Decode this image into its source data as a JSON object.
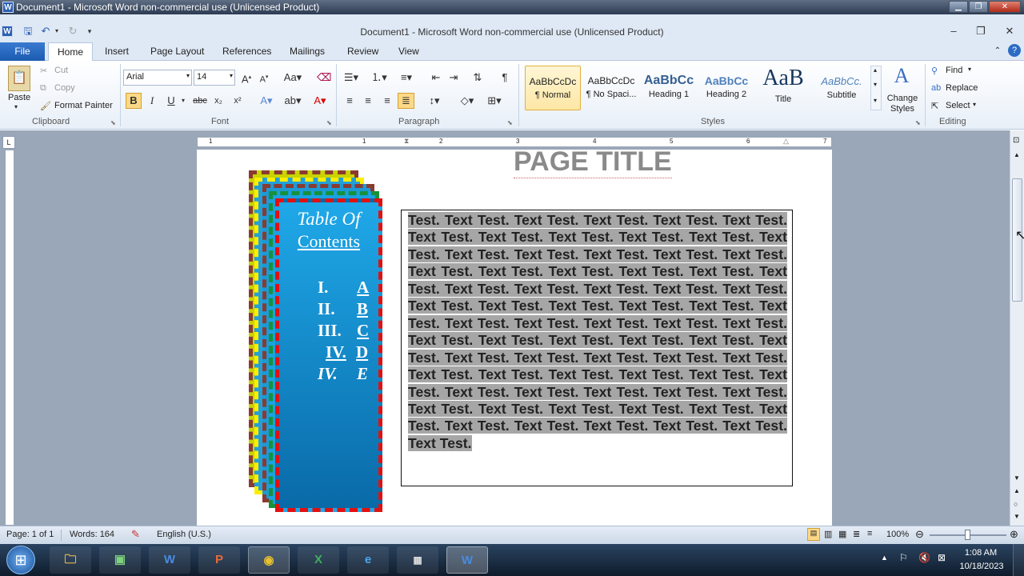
{
  "window": {
    "title": "Document1 - Microsoft Word non-commercial use (Unlicensed Product)",
    "doc_title": "Document1  -  Microsoft Word non-commercial use (Unlicensed Product)",
    "app_icon": "W"
  },
  "tabs": [
    "File",
    "Home",
    "Insert",
    "Page Layout",
    "References",
    "Mailings",
    "Review",
    "View"
  ],
  "ribbon": {
    "clipboard": {
      "paste": "Paste",
      "cut": "Cut",
      "copy": "Copy",
      "format_painter": "Format Painter",
      "label": "Clipboard"
    },
    "font": {
      "name": "Arial",
      "size": "14",
      "label": "Font"
    },
    "paragraph": {
      "label": "Paragraph"
    },
    "styles": {
      "label": "Styles",
      "items": [
        {
          "preview": "AaBbCcDc",
          "name": "¶ Normal"
        },
        {
          "preview": "AaBbCcDc",
          "name": "¶ No Spaci..."
        },
        {
          "preview": "AaBbCc",
          "name": "Heading 1"
        },
        {
          "preview": "AaBbCc",
          "name": "Heading 2"
        },
        {
          "preview": "AaB",
          "name": "Title"
        },
        {
          "preview": "AaBbCc.",
          "name": "Subtitle"
        }
      ],
      "change_styles": "Change Styles"
    },
    "editing": {
      "find": "Find",
      "replace": "Replace",
      "select": "Select",
      "label": "Editing"
    }
  },
  "ruler_numbers": [
    "1",
    "1",
    "2",
    "3",
    "4",
    "5",
    "6",
    "7"
  ],
  "document": {
    "page_title": "PAGE TITLE",
    "toc": {
      "heading1": "Table Of",
      "heading2": "Contents",
      "items": [
        {
          "num": "I.",
          "label": "A"
        },
        {
          "num": "II.",
          "label": "B"
        },
        {
          "num": "III.",
          "label": "C"
        },
        {
          "num": "IV.",
          "label": "D"
        },
        {
          "num": "IV.",
          "label": "E"
        }
      ]
    },
    "body_text": " Test. Text Test. Text Test. Text Test. Text Test. Text Test. Text Test. Text Test. Text Test. Text Test. Text Test. Text Test. Text Test. Text Test. Text Test. Text Test. Text Test. Text Test. Text Test. Text Test. Text Test. Text Test. Text Test. Text Test. Text Test. Text Test. Text Test. Text Test. Text Test. Text Test. Text Test. Text Test. Text Test. Text Test. Text Test. Text Test. Text Test. Text Test. Text Test. Text Test. Text Test. Text Test. Text Test. Text Test. Text Test. Text Test. Text Test. Text Test. Text Test. Text Test. Text Test. Text Test. Text Test. Text Test. Text Test. Text Test. Text Test. Text Test. Text Test. Text Test. Text Test. Text Test. Text Test. Text Test. Text Test. Text Test. Text Test. Text Test. Text Test. Text Test. Text Test. Text Test. Text Test."
  },
  "status": {
    "page": "Page: 1 of 1",
    "words": "Words: 164",
    "language": "English (U.S.)",
    "zoom": "100%"
  },
  "taskbar": {
    "time": "1:08 AM",
    "date": "10/18/2023"
  },
  "colors": {
    "ribbon_bg": "#dfe9f5",
    "file_tab": "#1b5bb0",
    "toc_fill": "#1fa8e8",
    "toc_border_red": "#e21010",
    "toc_border_green": "#17913a",
    "toc_border_yellow": "#ffee00",
    "toc_border_brown": "#8b3a30",
    "highlight": "#a6a6a6"
  }
}
